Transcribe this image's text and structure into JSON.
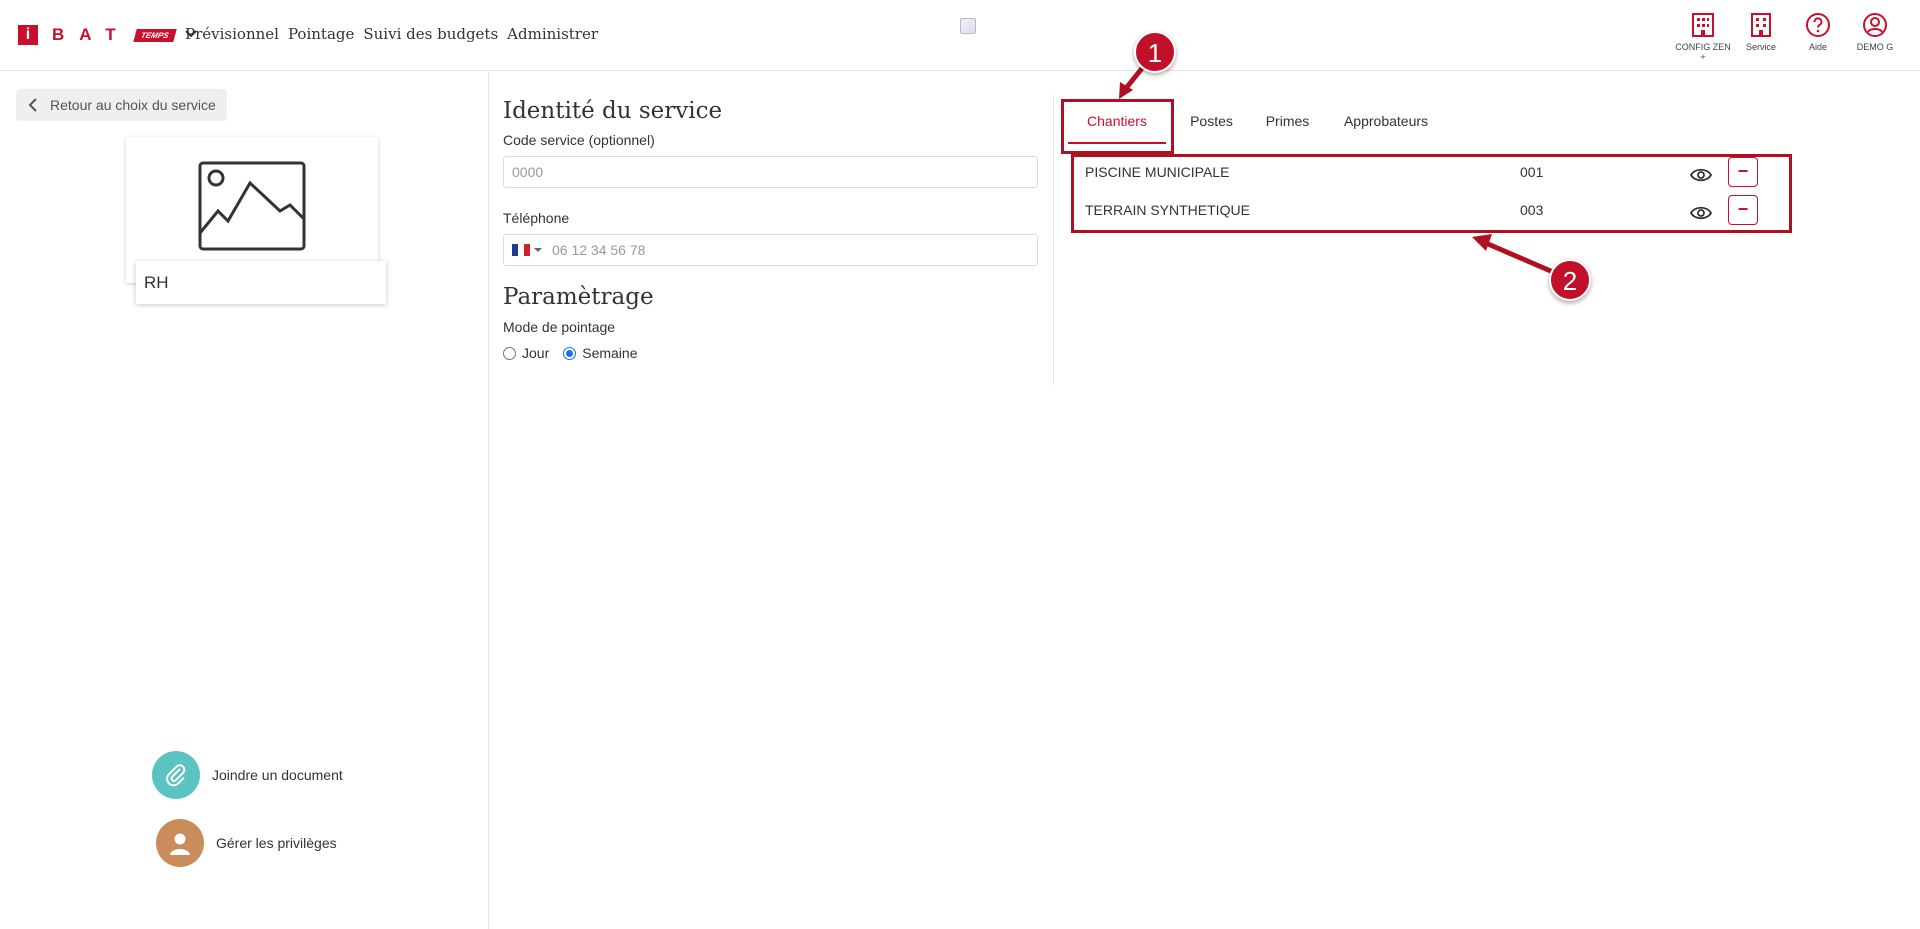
{
  "header": {
    "logo": {
      "mark": "i",
      "letters": "BAT",
      "badge": "TEMPS"
    },
    "nav": [
      "Prévisionnel",
      "Pointage",
      "Suivi des budgets",
      "Administrer"
    ],
    "icons": [
      {
        "label": "CONFIG ZEN +",
        "icon": "building-icon"
      },
      {
        "label": "Service",
        "icon": "building-icon"
      },
      {
        "label": "Aide",
        "icon": "help-icon"
      },
      {
        "label": "DEMO G",
        "icon": "user-icon"
      }
    ]
  },
  "sidebar": {
    "back_label": "Retour au choix du service",
    "service_name": "RH",
    "attach_label": "Joindre un document",
    "privileges_label": "Gérer les privilèges",
    "attach_color": "#5bc4c2",
    "privileges_color": "#c98c5a"
  },
  "form": {
    "identity_title": "Identité du service",
    "code_label": "Code service (optionnel)",
    "code_placeholder": "0000",
    "phone_label": "Téléphone",
    "phone_placeholder": "06 12 34 56 78",
    "settings_title": "Paramètrage",
    "mode_label": "Mode de pointage",
    "mode_options": [
      "Jour",
      "Semaine"
    ],
    "mode_selected": "Semaine"
  },
  "tabs": [
    "Chantiers",
    "Postes",
    "Primes",
    "Approbateurs"
  ],
  "active_tab": "Chantiers",
  "chantiers": [
    {
      "name": "PISCINE MUNICIPALE",
      "code": "001"
    },
    {
      "name": "TERRAIN SYNTHETIQUE",
      "code": "003"
    }
  ],
  "annotations": [
    "1",
    "2"
  ],
  "colors": {
    "brand": "#c8102e",
    "radio": "#1a73e8"
  }
}
